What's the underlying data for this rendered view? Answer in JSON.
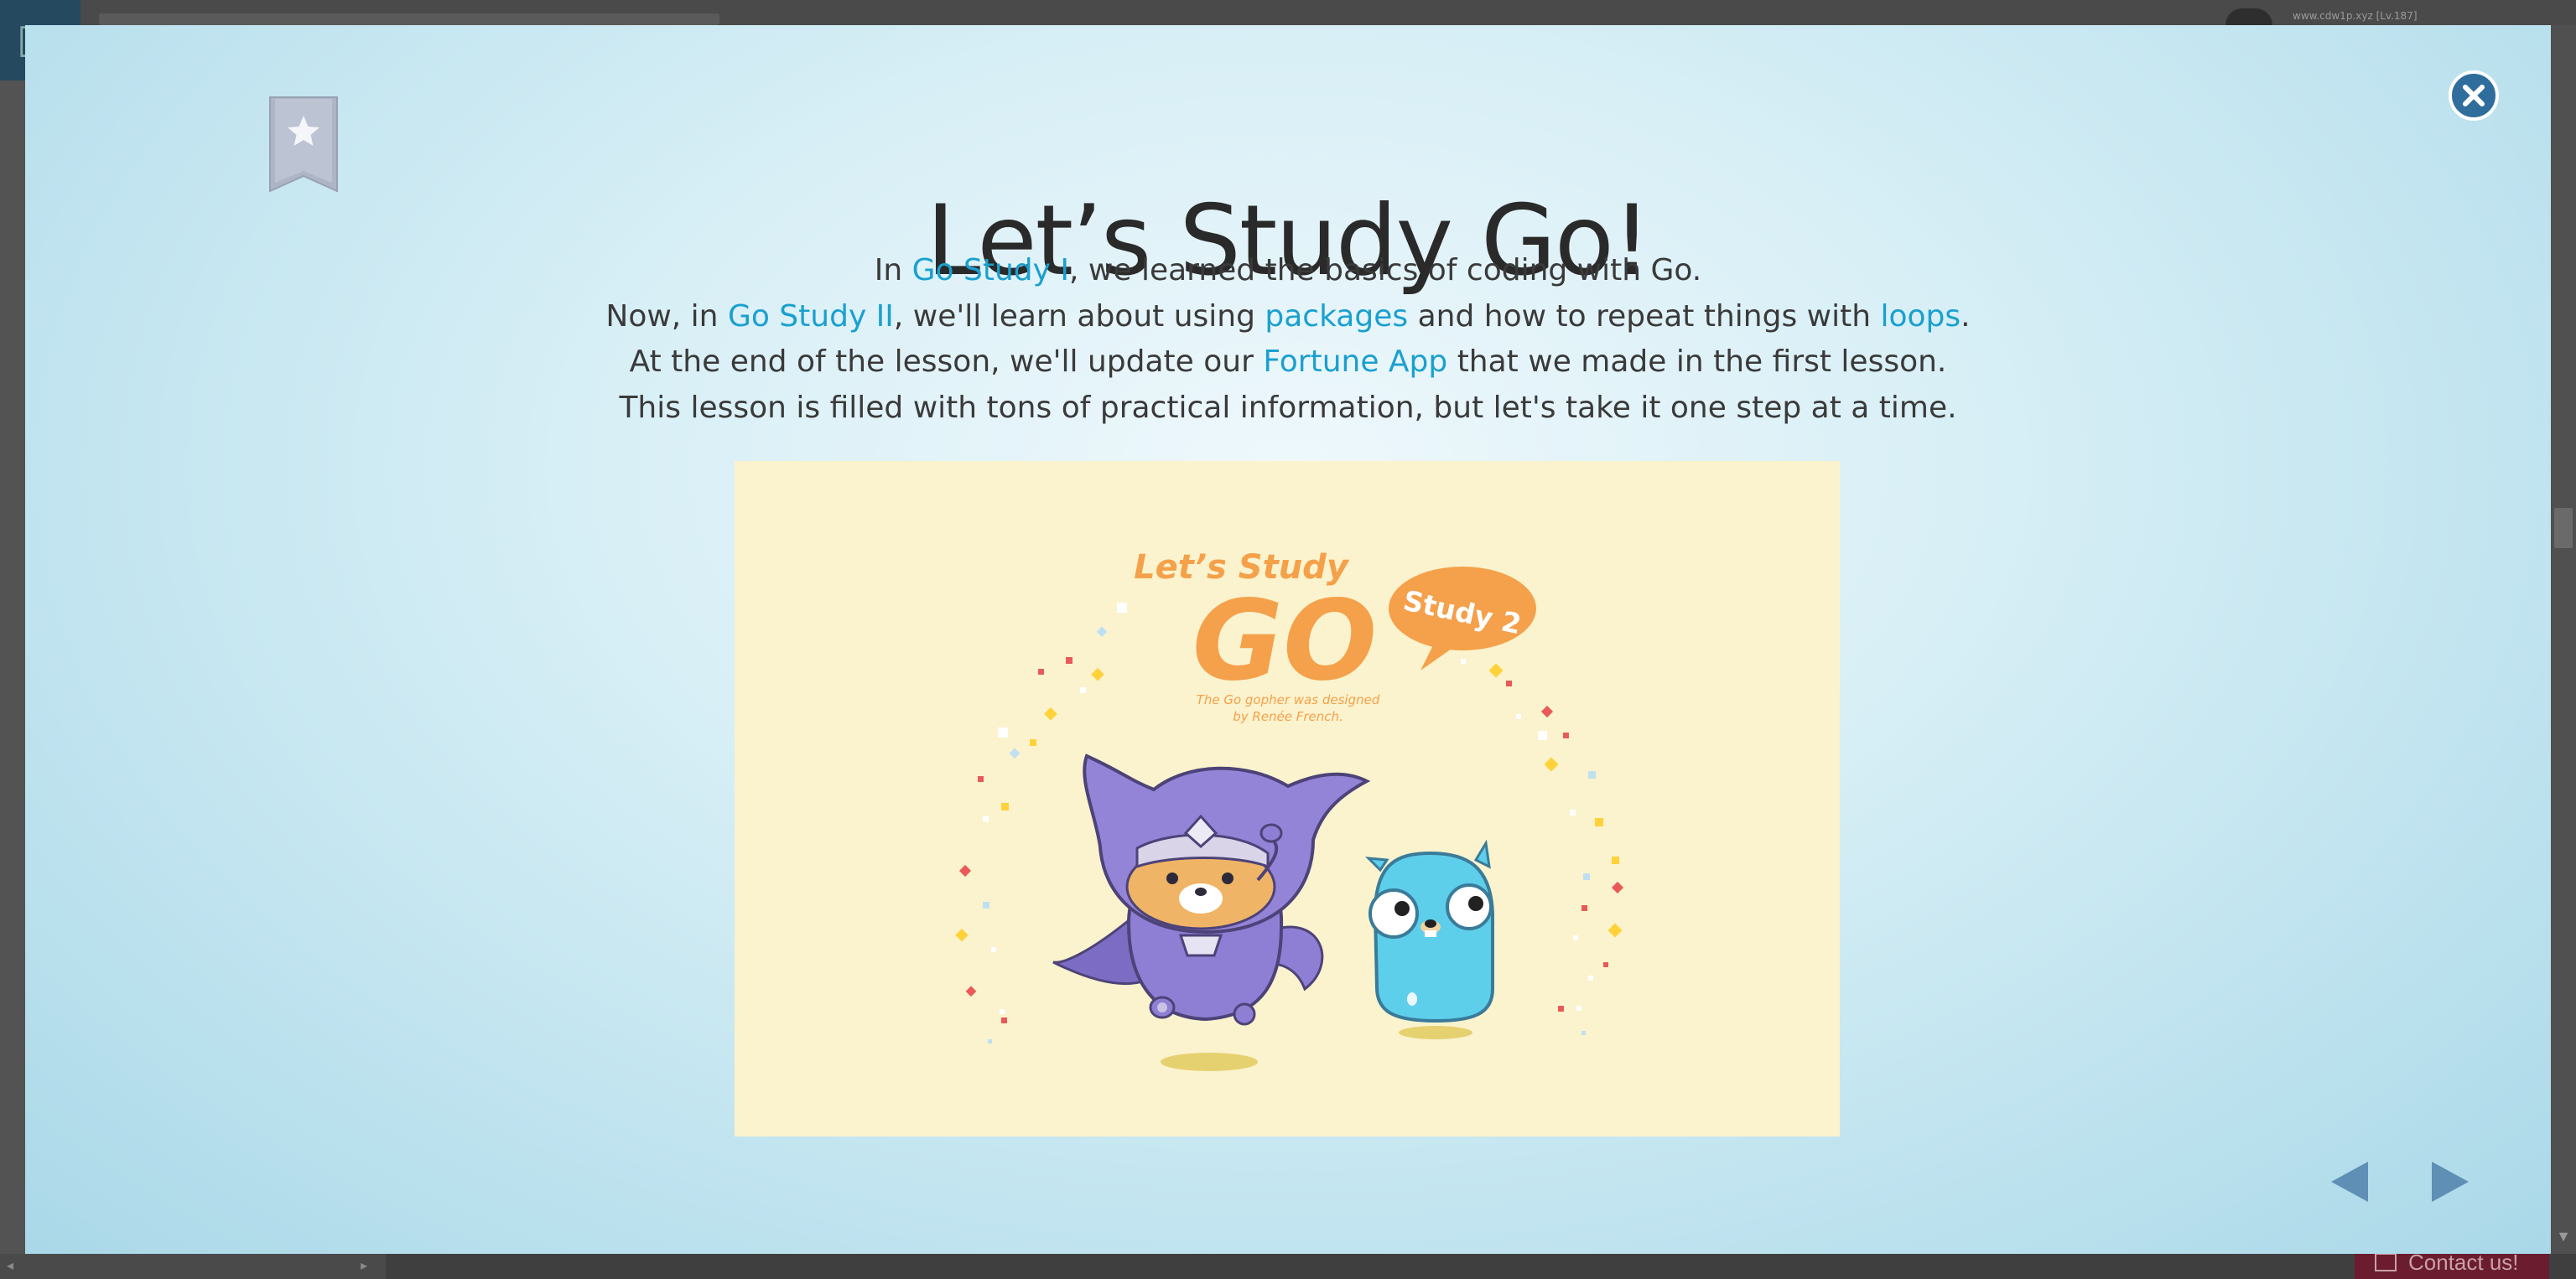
{
  "background": {
    "user_url": "www.cdw1p.xyz [Lv.187]",
    "contact_label": "Contact us!"
  },
  "modal": {
    "title": "Let’s Study Go!",
    "intro": {
      "line1": {
        "pre": "In ",
        "link": "Go Study I",
        "post": ", we learned the basics of coding with Go."
      },
      "line2": {
        "pre": "Now, in ",
        "link1": "Go Study II",
        "mid1": ", we'll learn about using ",
        "link2": "packages",
        "mid2": " and how to repeat things with ",
        "link3": "loops",
        "post": "."
      },
      "line3": {
        "pre": "At the end of the lesson, we'll update our ",
        "link": "Fortune App",
        "post": " that we made in the first lesson."
      },
      "line4": "This lesson is filled with tons of practical information, but let's take it one step at a time."
    },
    "hero": {
      "heading_small": "Let’s  Study",
      "heading_big": "GO",
      "badge": "Study 2",
      "credit_line1": "The Go gopher was designed",
      "credit_line2": "by Renée French."
    },
    "icons": {
      "bookmark": "bookmark-star-icon",
      "close": "close-icon",
      "prev": "triangle-left-icon",
      "next": "triangle-right-icon"
    },
    "colors": {
      "link": "#1aa0cf",
      "accent_orange": "#f5a04a",
      "close_bg": "#2f6e9c",
      "nav_arrow": "#5f8fb5"
    }
  }
}
